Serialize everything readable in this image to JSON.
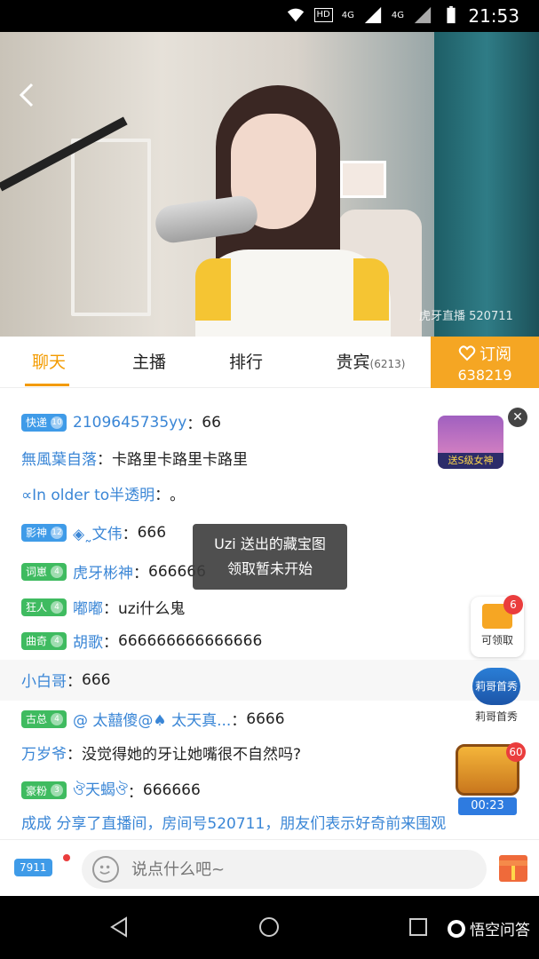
{
  "status_bar": {
    "time": "21:53",
    "hd_tag": "HD",
    "net1": "4G",
    "net2": "4G"
  },
  "video": {
    "watermark": "虎牙直播 520711"
  },
  "tabs": {
    "chat": "聊天",
    "anchor": "主播",
    "rank": "排行",
    "vip": "贵宾",
    "vip_count": "(6213)"
  },
  "subscribe": {
    "label": "订阅",
    "count": "638219"
  },
  "chat": [
    {
      "badge": "快递",
      "lv": "10",
      "badge_color": "blue",
      "nick": "2109645735yy",
      "text": "66"
    },
    {
      "badge": "",
      "nick": "無風葉自落",
      "text": "卡路里卡路里卡路里"
    },
    {
      "badge": "",
      "nick": "∝In older to半透明",
      "text": "。"
    },
    {
      "badge": "影神",
      "lv": "12",
      "badge_color": "blue",
      "nick": "◈˷文伟",
      "text": "666"
    },
    {
      "badge": "词崽",
      "lv": "4",
      "badge_color": "green",
      "nick": "虎牙彬神",
      "text": "666666"
    },
    {
      "badge": "狂人",
      "lv": "4",
      "badge_color": "green",
      "nick": "嘟嘟",
      "text": "uzi什么鬼"
    },
    {
      "badge": "曲奇",
      "lv": "4",
      "badge_color": "green",
      "nick": "胡歌",
      "text": "666666666666666"
    },
    {
      "badge": "",
      "nick": "小白哥",
      "text": "666"
    },
    {
      "badge": "古总",
      "lv": "4",
      "badge_color": "green",
      "nick": "@ 太囍傻@♠ 太天真...",
      "text": "6666"
    },
    {
      "badge": "",
      "nick": "万岁爷",
      "text": "没觉得她的牙让她嘴很不自然吗?"
    },
    {
      "badge": "豪粉",
      "lv": "3",
      "badge_color": "green",
      "nick": "ঔ天蝎ঔ",
      "text": "666666"
    }
  ],
  "system_message": "成成 分享了直播间，房间号520711，朋友们表示好奇前来围观",
  "tooltip": {
    "line1": "Uzi 送出的藏宝图",
    "line2": "领取暂未开始"
  },
  "widgets": {
    "game_ad_label": "送S级女神",
    "gift_box_label": "可领取",
    "gift_box_badge": "6",
    "hero_label": "莉哥首秀",
    "hero_icon_text": "莉哥首秀",
    "chest_badge": "60",
    "chest_timer": "00:23"
  },
  "input_bar": {
    "user_badge": "7911",
    "placeholder": "说点什么吧~"
  },
  "nav_bar": {
    "brand": "悟空问答"
  },
  "colors": {
    "accent": "#f39b00",
    "subscribe_bg": "#f5a623",
    "nick_blue": "#3a86d6"
  }
}
